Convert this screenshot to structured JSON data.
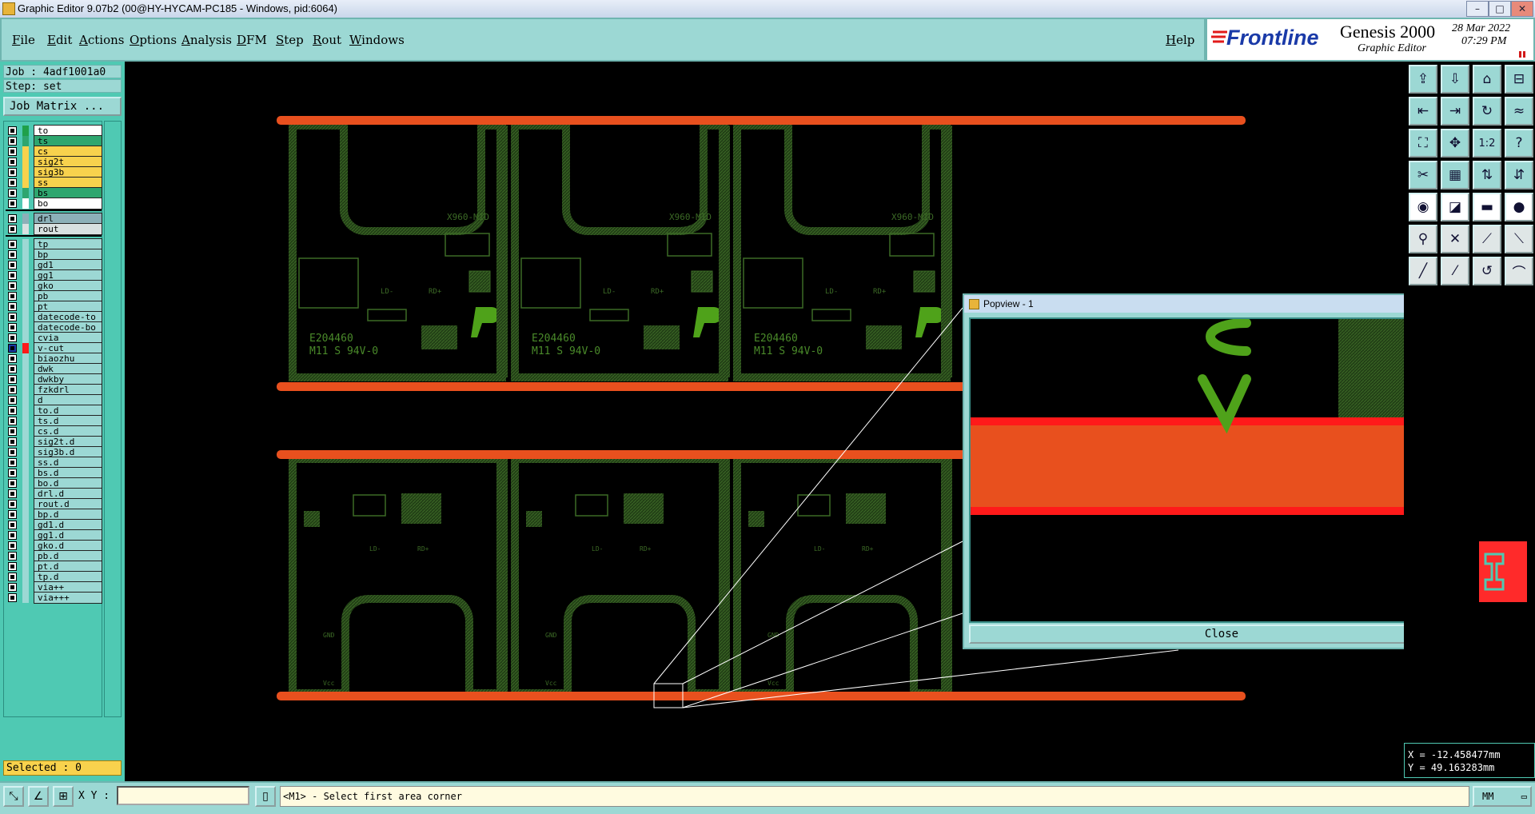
{
  "window": {
    "title": "Graphic Editor 9.07b2 (00@HY-HYCAM-PC185 - Windows, pid:6064)",
    "buttons": {
      "minimize": "–",
      "maximize": "□",
      "close": "✕"
    }
  },
  "menubar": {
    "items": [
      "File",
      "Edit",
      "Actions",
      "Options",
      "Analysis",
      "DFM",
      "Step",
      "Rout",
      "Windows"
    ],
    "help": "Help"
  },
  "brand": {
    "logo": "Frontline",
    "product": "Genesis 2000",
    "subtitle": "Graphic Editor",
    "date": "28 Mar 2022",
    "time": "07:29 PM"
  },
  "job": {
    "job_label": "Job : 4adf1001a0",
    "step_label": "Step: set",
    "matrix_button": "Job Matrix ..."
  },
  "colors": {
    "teal": "#9cd8d4",
    "layer_green": "#2ea66f",
    "layer_yellow": "#f8d24d",
    "board_green": "#2f5a1e",
    "rail_orange": "#e8501e",
    "vcut_red": "#ff1a1a"
  },
  "layers": [
    {
      "name": "to",
      "fill": "#ffffff",
      "marker": "#1fa04a"
    },
    {
      "name": "ts",
      "fill": "#2ea66f",
      "marker": "#2ea66f"
    },
    {
      "name": "cs",
      "fill": "#f8d24d",
      "marker": "#f8d24d"
    },
    {
      "name": "sig2t",
      "fill": "#f8d24d",
      "marker": "#f8d24d"
    },
    {
      "name": "sig3b",
      "fill": "#f8d24d",
      "marker": "#f8d24d"
    },
    {
      "name": "ss",
      "fill": "#f8d24d",
      "marker": "#f8d24d"
    },
    {
      "name": "bs",
      "fill": "#2ea66f",
      "marker": "#2ea66f"
    },
    {
      "name": "bo",
      "fill": "#ffffff",
      "marker": "#ffffff"
    },
    {
      "name": "drl",
      "fill": "#8cb0b8",
      "marker": "#8cb0b8",
      "gap": true
    },
    {
      "name": "rout",
      "fill": "#d8e0e0",
      "marker": "#d8e0e0"
    },
    {
      "name": "tp",
      "fill": "#9cd8d4",
      "marker": "#9cd8d4",
      "gap": true
    },
    {
      "name": "bp",
      "fill": "#9cd8d4",
      "marker": "#9cd8d4"
    },
    {
      "name": "gd1",
      "fill": "#9cd8d4",
      "marker": "#9cd8d4"
    },
    {
      "name": "gg1",
      "fill": "#9cd8d4",
      "marker": "#9cd8d4"
    },
    {
      "name": "gko",
      "fill": "#9cd8d4",
      "marker": "#9cd8d4"
    },
    {
      "name": "pb",
      "fill": "#9cd8d4",
      "marker": "#9cd8d4"
    },
    {
      "name": "pt",
      "fill": "#9cd8d4",
      "marker": "#9cd8d4"
    },
    {
      "name": "datecode-to",
      "fill": "#9cd8d4",
      "marker": "#9cd8d4"
    },
    {
      "name": "datecode-bo",
      "fill": "#9cd8d4",
      "marker": "#9cd8d4"
    },
    {
      "name": "cvia",
      "fill": "#9cd8d4",
      "marker": "#9cd8d4"
    },
    {
      "name": "v-cut",
      "fill": "#9cd8d4",
      "marker": "#ff1a1a",
      "active": true
    },
    {
      "name": "biaozhu",
      "fill": "#9cd8d4",
      "marker": "#9cd8d4"
    },
    {
      "name": "dwk",
      "fill": "#9cd8d4",
      "marker": "#9cd8d4"
    },
    {
      "name": "dwkby",
      "fill": "#9cd8d4",
      "marker": "#9cd8d4"
    },
    {
      "name": "fzkdrl",
      "fill": "#9cd8d4",
      "marker": "#9cd8d4"
    },
    {
      "name": "d",
      "fill": "#9cd8d4",
      "marker": "#9cd8d4"
    },
    {
      "name": "to.d",
      "fill": "#9cd8d4",
      "marker": "#9cd8d4"
    },
    {
      "name": "ts.d",
      "fill": "#9cd8d4",
      "marker": "#9cd8d4"
    },
    {
      "name": "cs.d",
      "fill": "#9cd8d4",
      "marker": "#9cd8d4"
    },
    {
      "name": "sig2t.d",
      "fill": "#9cd8d4",
      "marker": "#9cd8d4"
    },
    {
      "name": "sig3b.d",
      "fill": "#9cd8d4",
      "marker": "#9cd8d4"
    },
    {
      "name": "ss.d",
      "fill": "#9cd8d4",
      "marker": "#9cd8d4"
    },
    {
      "name": "bs.d",
      "fill": "#9cd8d4",
      "marker": "#9cd8d4"
    },
    {
      "name": "bo.d",
      "fill": "#9cd8d4",
      "marker": "#9cd8d4"
    },
    {
      "name": "drl.d",
      "fill": "#9cd8d4",
      "marker": "#9cd8d4"
    },
    {
      "name": "rout.d",
      "fill": "#9cd8d4",
      "marker": "#9cd8d4"
    },
    {
      "name": "bp.d",
      "fill": "#9cd8d4",
      "marker": "#9cd8d4"
    },
    {
      "name": "gd1.d",
      "fill": "#9cd8d4",
      "marker": "#9cd8d4"
    },
    {
      "name": "gg1.d",
      "fill": "#9cd8d4",
      "marker": "#9cd8d4"
    },
    {
      "name": "gko.d",
      "fill": "#9cd8d4",
      "marker": "#9cd8d4"
    },
    {
      "name": "pb.d",
      "fill": "#9cd8d4",
      "marker": "#9cd8d4"
    },
    {
      "name": "pt.d",
      "fill": "#9cd8d4",
      "marker": "#9cd8d4"
    },
    {
      "name": "tp.d",
      "fill": "#9cd8d4",
      "marker": "#9cd8d4"
    },
    {
      "name": "via++",
      "fill": "#9cd8d4",
      "marker": "#9cd8d4"
    },
    {
      "name": "via+++",
      "fill": "#9cd8d4",
      "marker": "#9cd8d4"
    }
  ],
  "selected_label": "Selected : 0",
  "board": {
    "marking_1": "E204460",
    "marking_2": "M11 S 94V-0",
    "model": "X960-MID",
    "ld_label": "LD-",
    "rd_label": "RD+",
    "gnd_label": "GND",
    "vcc_label": "Vcc"
  },
  "popview": {
    "title": "Popview - 1",
    "close_label": "Close"
  },
  "toolbox": {
    "icons": [
      "open-icon",
      "save-icon",
      "home-icon",
      "split-view-icon",
      "pan-left-icon",
      "pan-right-icon",
      "redraw-icon",
      "snake-icon",
      "zoom-fit-icon",
      "zoom-center-icon",
      "ratio-icon",
      "help-icon",
      "measure-icon",
      "grid-icon",
      "layer-up-icon",
      "layer-down-icon",
      "camera-icon",
      "highlight-icon",
      "ruler-icon",
      "dot-icon",
      "node-icon",
      "cross-icon",
      "connect-icon",
      "route-icon",
      "draw-line-icon",
      "slash-icon",
      "curve-icon",
      "arc-icon"
    ],
    "ratio_text": "1:2",
    "coord_x": "X = -12.458477mm",
    "coord_y": "Y =  49.163283mm"
  },
  "statusbar": {
    "xy_label": "X Y :",
    "xy_value": "",
    "message": "<M1> - Select first area corner",
    "units": "MM"
  }
}
